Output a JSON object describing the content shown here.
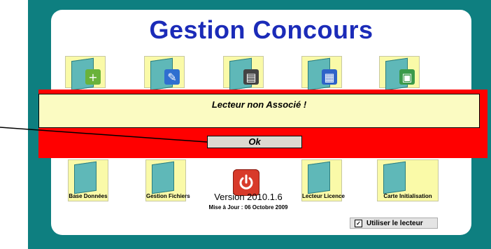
{
  "app": {
    "title": "Gestion Concours"
  },
  "tiles": {
    "base_donnees": "Base Données",
    "gestion_fichiers": "Gestion Fichiers",
    "lecteur_licence": "Lecteur Licence",
    "carte_initialisation": "Carte Initialisation"
  },
  "dialog": {
    "message": "Lecteur non Associé !",
    "ok_label": "Ok"
  },
  "footer": {
    "version": "Version 2010.1.6",
    "update": "Mise à Jour : 06 Octobre 2009",
    "checkbox_label": "Utiliser le lecteur",
    "checkbox_checked": true
  },
  "colors": {
    "background": "#0e7f80",
    "title": "#1b2bb8",
    "dialog_band": "#ff0000",
    "message_box": "#fbfbc2",
    "tile": "#fafaa8"
  }
}
